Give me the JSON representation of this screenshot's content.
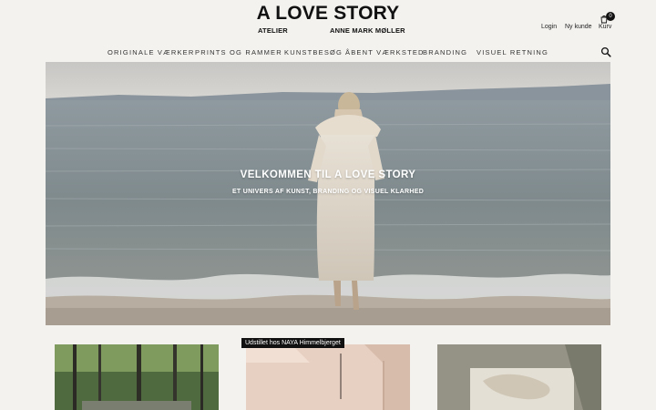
{
  "header": {
    "logo_title": "A LOVE STORY",
    "logo_left": "ATELIER",
    "logo_right": "ANNE MARK MØLLER",
    "login": "Login",
    "new_customer": "Ny kunde",
    "cart_count": "0",
    "cart_label": "Kurv",
    "search_icon": "search-icon",
    "cart_icon": "cart-icon"
  },
  "nav": {
    "items": [
      "ORIGINALE VÆRKER",
      "PRINTS OG RAMMER",
      "KUNSTBESØG",
      "ÅBENT VÆRKSTED",
      "BRANDING",
      "VISUEL RETNING"
    ]
  },
  "hero": {
    "title": "VELKOMMEN TIL A LOVE STORY",
    "subtitle": "ET UNIVERS AF KUNST, BRANDING OG VISUEL KLARHED"
  },
  "cards": {
    "tag": "Udstillet hos NAYA Himmelbjerget"
  },
  "colors": {
    "background": "#f3f2ef",
    "text": "#111111",
    "badge": "#111111"
  }
}
